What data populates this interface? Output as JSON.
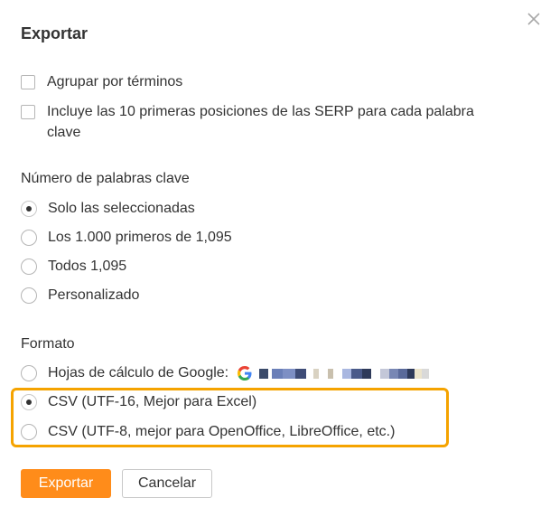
{
  "dialog": {
    "title": "Exportar",
    "close_icon": "close-icon"
  },
  "options": {
    "group_by_terms": {
      "label": "Agrupar por términos",
      "checked": false
    },
    "include_serp": {
      "label_line1": "Incluye las 10 primeras posiciones de las SERP para cada palabra",
      "label_line2": "clave",
      "checked": false
    }
  },
  "keyword_count": {
    "heading": "Número de palabras clave",
    "items": [
      {
        "label": "Solo las seleccionadas",
        "checked": true
      },
      {
        "label": "Los 1.000 primeros de 1,095",
        "checked": false
      },
      {
        "label": "Todos 1,095",
        "checked": false
      },
      {
        "label": "Personalizado",
        "checked": false
      }
    ]
  },
  "format": {
    "heading": "Formato",
    "items": [
      {
        "label": "Hojas de cálculo de Google:",
        "checked": false,
        "icon": "google-icon"
      },
      {
        "label": "CSV (UTF-16, Mejor para Excel)",
        "checked": true
      },
      {
        "label": "CSV (UTF-8, mejor para OpenOffice, LibreOffice, etc.)",
        "checked": false
      }
    ]
  },
  "buttons": {
    "export_label": "Exportar",
    "cancel_label": "Cancelar"
  },
  "colors": {
    "accent": "#ff8c1a",
    "highlight_border": "#f5a300"
  }
}
